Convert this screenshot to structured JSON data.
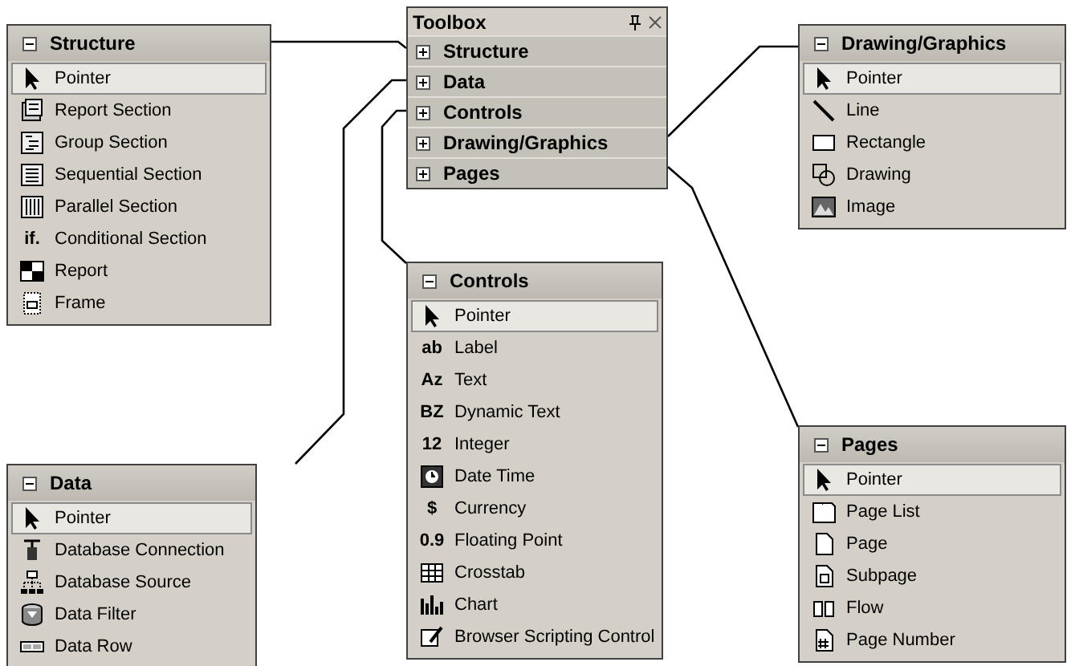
{
  "toolbox": {
    "title": "Toolbox",
    "categories": [
      {
        "label": "Structure",
        "expanded": false
      },
      {
        "label": "Data",
        "expanded": false
      },
      {
        "label": "Controls",
        "expanded": false
      },
      {
        "label": "Drawing/Graphics",
        "expanded": false
      },
      {
        "label": "Pages",
        "expanded": false
      }
    ]
  },
  "panels": [
    {
      "title": "Structure",
      "expanded": true,
      "items": [
        {
          "label": "Pointer",
          "selected": true,
          "kind": "pointer"
        },
        {
          "label": "Report Section",
          "selected": false,
          "kind": "reportsection"
        },
        {
          "label": "Group Section",
          "selected": false,
          "kind": "groupsection"
        },
        {
          "label": "Sequential Section",
          "selected": false,
          "kind": "sequential"
        },
        {
          "label": "Parallel Section",
          "selected": false,
          "kind": "parallel"
        },
        {
          "label": "Conditional Section",
          "selected": false,
          "kind": "glyph",
          "icon_text": "if."
        },
        {
          "label": "Report",
          "selected": false,
          "kind": "report"
        },
        {
          "label": "Frame",
          "selected": false,
          "kind": "frame"
        }
      ]
    },
    {
      "title": "Drawing/Graphics",
      "expanded": true,
      "items": [
        {
          "label": "Pointer",
          "selected": true,
          "kind": "pointer"
        },
        {
          "label": "Line",
          "selected": false,
          "kind": "line"
        },
        {
          "label": "Rectangle",
          "selected": false,
          "kind": "rectangle"
        },
        {
          "label": "Drawing",
          "selected": false,
          "kind": "drawing"
        },
        {
          "label": "Image",
          "selected": false,
          "kind": "image"
        }
      ]
    },
    {
      "title": "Data",
      "expanded": true,
      "items": [
        {
          "label": "Pointer",
          "selected": true,
          "kind": "pointer"
        },
        {
          "label": "Database Connection",
          "selected": false,
          "kind": "connection"
        },
        {
          "label": "Database Source",
          "selected": false,
          "kind": "source"
        },
        {
          "label": "Data Filter",
          "selected": false,
          "kind": "filter"
        },
        {
          "label": "Data Row",
          "selected": false,
          "kind": "row"
        }
      ]
    },
    {
      "title": "Controls",
      "expanded": true,
      "items": [
        {
          "label": "Pointer",
          "selected": true,
          "kind": "pointer"
        },
        {
          "label": "Label",
          "selected": false,
          "kind": "glyph",
          "icon_text": "ab"
        },
        {
          "label": "Text",
          "selected": false,
          "kind": "glyph",
          "icon_text": "Az"
        },
        {
          "label": "Dynamic Text",
          "selected": false,
          "kind": "glyph",
          "icon_text": "BZ"
        },
        {
          "label": "Integer",
          "selected": false,
          "kind": "glyph",
          "icon_text": "12"
        },
        {
          "label": "Date Time",
          "selected": false,
          "kind": "datetime"
        },
        {
          "label": "Currency",
          "selected": false,
          "kind": "glyph",
          "icon_text": "$"
        },
        {
          "label": "Floating Point",
          "selected": false,
          "kind": "glyph",
          "icon_text": "0.9"
        },
        {
          "label": "Crosstab",
          "selected": false,
          "kind": "crosstab"
        },
        {
          "label": "Chart",
          "selected": false,
          "kind": "chart"
        },
        {
          "label": "Browser Scripting Control",
          "selected": false,
          "kind": "script"
        }
      ]
    },
    {
      "title": "Pages",
      "expanded": true,
      "items": [
        {
          "label": "Pointer",
          "selected": true,
          "kind": "pointer"
        },
        {
          "label": "Page List",
          "selected": false,
          "kind": "pagelist"
        },
        {
          "label": "Page",
          "selected": false,
          "kind": "page"
        },
        {
          "label": "Subpage",
          "selected": false,
          "kind": "subpage"
        },
        {
          "label": "Flow",
          "selected": false,
          "kind": "flow"
        },
        {
          "label": "Page Number",
          "selected": false,
          "kind": "pagenumber"
        }
      ]
    }
  ]
}
